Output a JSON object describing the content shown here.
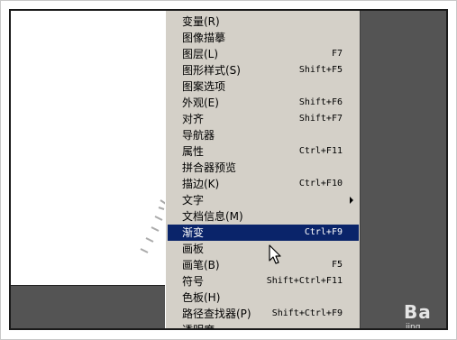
{
  "menu": {
    "items": [
      {
        "label": "变量(R)",
        "shortcut": "",
        "submenu": false,
        "selected": false
      },
      {
        "label": "图像描摹",
        "shortcut": "",
        "submenu": false,
        "selected": false
      },
      {
        "label": "图层(L)",
        "shortcut": "F7",
        "submenu": false,
        "selected": false
      },
      {
        "label": "图形样式(S)",
        "shortcut": "Shift+F5",
        "submenu": false,
        "selected": false
      },
      {
        "label": "图案选项",
        "shortcut": "",
        "submenu": false,
        "selected": false
      },
      {
        "label": "外观(E)",
        "shortcut": "Shift+F6",
        "submenu": false,
        "selected": false
      },
      {
        "label": "对齐",
        "shortcut": "Shift+F7",
        "submenu": false,
        "selected": false
      },
      {
        "label": "导航器",
        "shortcut": "",
        "submenu": false,
        "selected": false
      },
      {
        "label": "属性",
        "shortcut": "Ctrl+F11",
        "submenu": false,
        "selected": false
      },
      {
        "label": "拼合器预览",
        "shortcut": "",
        "submenu": false,
        "selected": false
      },
      {
        "label": "描边(K)",
        "shortcut": "Ctrl+F10",
        "submenu": false,
        "selected": false
      },
      {
        "label": "文字",
        "shortcut": "",
        "submenu": true,
        "selected": false
      },
      {
        "label": "文档信息(M)",
        "shortcut": "",
        "submenu": false,
        "selected": false
      },
      {
        "label": "渐变",
        "shortcut": "Ctrl+F9",
        "submenu": false,
        "selected": true
      },
      {
        "label": "画板",
        "shortcut": "",
        "submenu": false,
        "selected": false
      },
      {
        "label": "画笔(B)",
        "shortcut": "F5",
        "submenu": false,
        "selected": false
      },
      {
        "label": "符号",
        "shortcut": "Shift+Ctrl+F11",
        "submenu": false,
        "selected": false
      },
      {
        "label": "色板(H)",
        "shortcut": "",
        "submenu": false,
        "selected": false
      },
      {
        "label": "路径查找器(P)",
        "shortcut": "Shift+Ctrl+F9",
        "submenu": false,
        "selected": false
      },
      {
        "label": "透明度",
        "shortcut": "",
        "submenu": false,
        "selected": false
      }
    ]
  },
  "watermark": {
    "text": "Ba",
    "sub": "jing"
  },
  "colors": {
    "menu_bg": "#d4d0c8",
    "selected_bg": "#0a246a",
    "workspace_bg": "#545454"
  }
}
